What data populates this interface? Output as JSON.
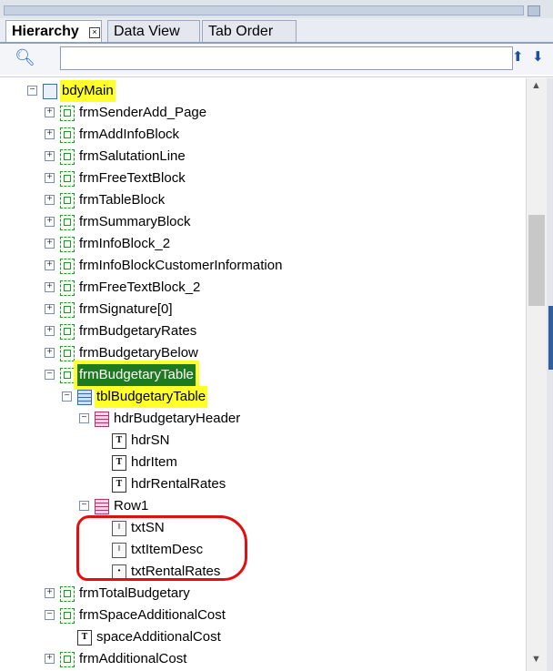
{
  "tabs": {
    "hierarchy": "Hierarchy",
    "data_view": "Data View",
    "tab_order": "Tab Order"
  },
  "search": {
    "placeholder": ""
  },
  "tree": [
    {
      "label": "bdyMain",
      "icon": "page-icon",
      "expander": "minus",
      "highlight": "yellow"
    },
    {
      "label": "frmSenderAdd_Page",
      "icon": "form-icon",
      "expander": "plus"
    },
    {
      "label": "frmAddInfoBlock",
      "icon": "form-icon",
      "expander": "plus"
    },
    {
      "label": "frmSalutationLine",
      "icon": "form-icon",
      "expander": "plus"
    },
    {
      "label": "frmFreeTextBlock",
      "icon": "form-icon",
      "expander": "plus"
    },
    {
      "label": "frmTableBlock",
      "icon": "form-icon",
      "expander": "plus"
    },
    {
      "label": "frmSummaryBlock",
      "icon": "form-icon",
      "expander": "plus"
    },
    {
      "label": "frmInfoBlock_2",
      "icon": "form-icon",
      "expander": "plus"
    },
    {
      "label": "frmInfoBlockCustomerInformation",
      "icon": "form-icon",
      "expander": "plus"
    },
    {
      "label": "frmFreeTextBlock_2",
      "icon": "form-icon",
      "expander": "plus"
    },
    {
      "label": "frmSignature[0]",
      "icon": "form-icon",
      "expander": "plus"
    },
    {
      "label": "frmBudgetaryRates",
      "icon": "form-icon",
      "expander": "plus"
    },
    {
      "label": "frmBudgetaryBelow",
      "icon": "form-icon",
      "expander": "plus"
    },
    {
      "label": "frmBudgetaryTable",
      "icon": "form-icon",
      "expander": "minus",
      "highlight": "selected"
    },
    {
      "label": "tblBudgetaryTable",
      "icon": "table-icon",
      "expander": "minus",
      "highlight": "yellow"
    },
    {
      "label": "hdrBudgetaryHeader",
      "icon": "header-row-icon",
      "expander": "minus"
    },
    {
      "label": "hdrSN",
      "icon": "text-icon"
    },
    {
      "label": "hdrItem",
      "icon": "text-icon"
    },
    {
      "label": "hdrRentalRates",
      "icon": "text-icon"
    },
    {
      "label": "Row1",
      "icon": "row-icon",
      "expander": "minus"
    },
    {
      "label": "txtSN",
      "icon": "textfield-icon"
    },
    {
      "label": "txtItemDesc",
      "icon": "textfield-icon"
    },
    {
      "label": "txtRentalRates",
      "icon": "numfield-icon"
    },
    {
      "label": "frmTotalBudgetary",
      "icon": "form-icon",
      "expander": "plus"
    },
    {
      "label": "frmSpaceAdditionalCost",
      "icon": "form-icon",
      "expander": "minus"
    },
    {
      "label": "spaceAdditionalCost",
      "icon": "text-icon"
    },
    {
      "label": "frmAdditionalCost",
      "icon": "form-icon",
      "expander": "plus"
    }
  ],
  "colors": {
    "highlight": "#ffff29",
    "selected": "#1e7a1e",
    "annotation": "#e01010"
  }
}
